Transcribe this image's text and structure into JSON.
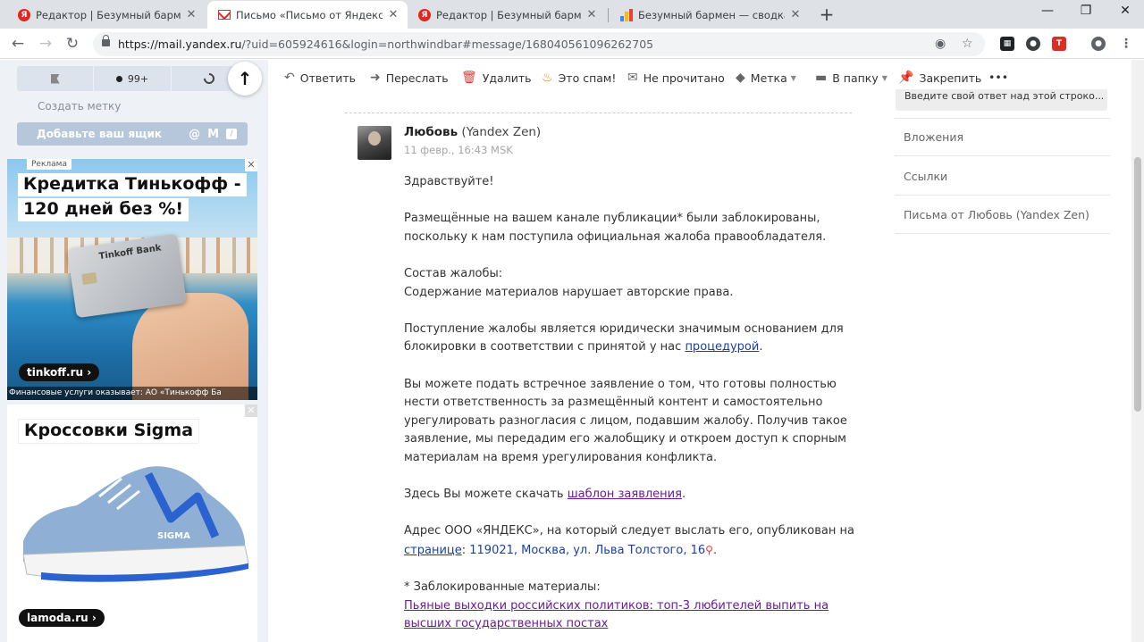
{
  "browser": {
    "tabs": [
      {
        "title": "Редактор | Безумный бармен | Я",
        "icon": "yandex-icon",
        "active": false
      },
      {
        "title": "Письмо «Письмо от Яндекс.Дзе",
        "icon": "mail-icon",
        "active": true
      },
      {
        "title": "Редактор | Безумный бармен | Я",
        "icon": "yandex-icon",
        "active": false
      },
      {
        "title": "Безумный бармен — сводка —",
        "icon": "sheets-icon",
        "active": false
      }
    ],
    "url_host": "https://mail.yandex.ru",
    "url_rest": "/?uid=605924616&login=northwindbar#message/168040561096262705"
  },
  "sidebar": {
    "filters": {
      "unread_count": "99+"
    },
    "create_label": "Создать метку",
    "add_mailbox": "Добавьте ваш ящик"
  },
  "ads": [
    {
      "tag": "Реклама",
      "title_line1": "Кредитка Тинькофф -",
      "title_line2": "120 дней без %!",
      "card_brand": "Tinkoff Bank",
      "domain": "tinkoff.ru ›",
      "footer": "Финансовые услуги оказывает: АО «Тинькофф Ба"
    },
    {
      "title": "Кроссовки Sigma",
      "shoe_brand": "SIGMA",
      "domain": "lamoda.ru ›"
    }
  ],
  "actions": {
    "reply": "Ответить",
    "forward": "Переслать",
    "delete": "Удалить",
    "spam": "Это спам!",
    "unread": "Не прочитано",
    "label": "Метка",
    "folder": "В папку",
    "pin": "Закрепить",
    "more": "•••"
  },
  "message": {
    "sender_name": "Любовь",
    "sender_org": "(Yandex Zen)",
    "date": "11 февр., 16:43 MSK",
    "greeting": "Здравствуйте!",
    "p1": "Размещённые на вашем канале публикации* были заблокированы, поскольку к нам поступила официальная жалоба правообладателя.",
    "p2_title": "Состав жалобы:",
    "p2_body": "Содержание материалов нарушает авторские права.",
    "p3_text": "Поступление жалобы является юридически значимым основанием для блокировки в соответствии с принятой у нас ",
    "p3_link": "процедурой",
    "p3_end": ".",
    "p4": "Вы можете подать встречное заявление о том, что готовы полностью нести ответственность за размещённый контент и самостоятельно урегулировать разногласия с лицом, подавшим жалобу. Получив такое заявление, мы передадим его жалобщику и откроем доступ к спорным материалам на время урегулирования конфликта.",
    "p5_text": "Здесь Вы можете скачать ",
    "p5_link": "шаблон заявления",
    "p5_end": ".",
    "p6_text": "Адрес ООО «ЯНДЕКС», на который следует выслать его, опубликован на ",
    "p6_link": "странице",
    "p6_sep": ": ",
    "p6_address": "119021, Москва, ул. Льва Толстого, 16",
    "p6_end": ".",
    "blocked_title": "* Заблокированные материалы:",
    "blocked_link1": "Пьяные выходки российских политиков: топ-3 любителей выпить на высших государственных постах"
  },
  "right_panel": {
    "reply_hint": "Введите свой ответ над этой строко...",
    "items": [
      "Вложения",
      "Ссылки",
      "Письма от Любовь (Yandex Zen)"
    ]
  }
}
